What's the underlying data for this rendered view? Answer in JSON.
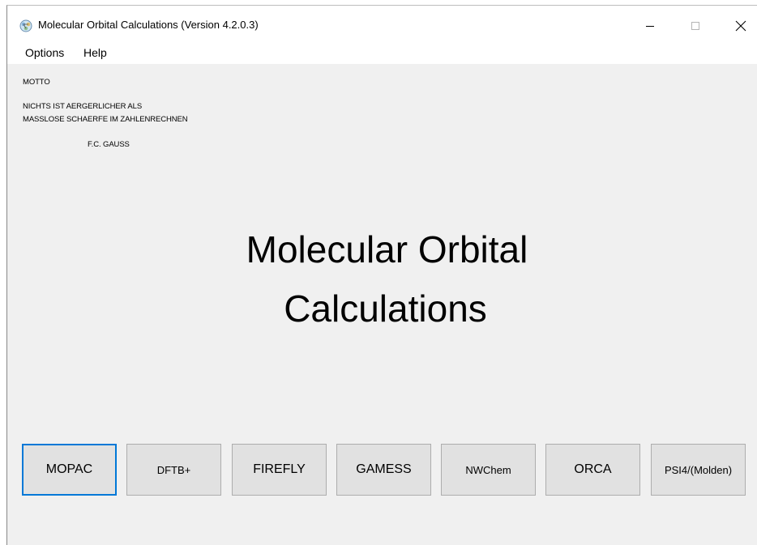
{
  "window": {
    "title": "Molecular Orbital Calculations (Version 4.2.0.3)",
    "icon": "molecule-app-icon",
    "controls": [
      "minimize-icon",
      "maximize-icon",
      "close-icon"
    ]
  },
  "menu": {
    "options": "Options",
    "help": "Help"
  },
  "motto": {
    "label": "MOTTO",
    "line1": "NICHTS IST AERGERLICHER ALS",
    "line2": "MASSLOSE SCHAERFE IM ZAHLENRECHNEN",
    "author": "F.C. GAUSS"
  },
  "heading": {
    "line1": "Molecular Orbital",
    "line2": "Calculations"
  },
  "programs": {
    "mopac": "MOPAC",
    "dftb": "DFTB+",
    "firefly": "FIREFLY",
    "gamess": "GAMESS",
    "nwchem": "NWChem",
    "orca": "ORCA",
    "psi4": "PSI4/(Molden)"
  },
  "colors": {
    "window_bg": "#f0f0f0",
    "button_bg": "#e1e1e1",
    "focus_border": "#0078d7"
  }
}
